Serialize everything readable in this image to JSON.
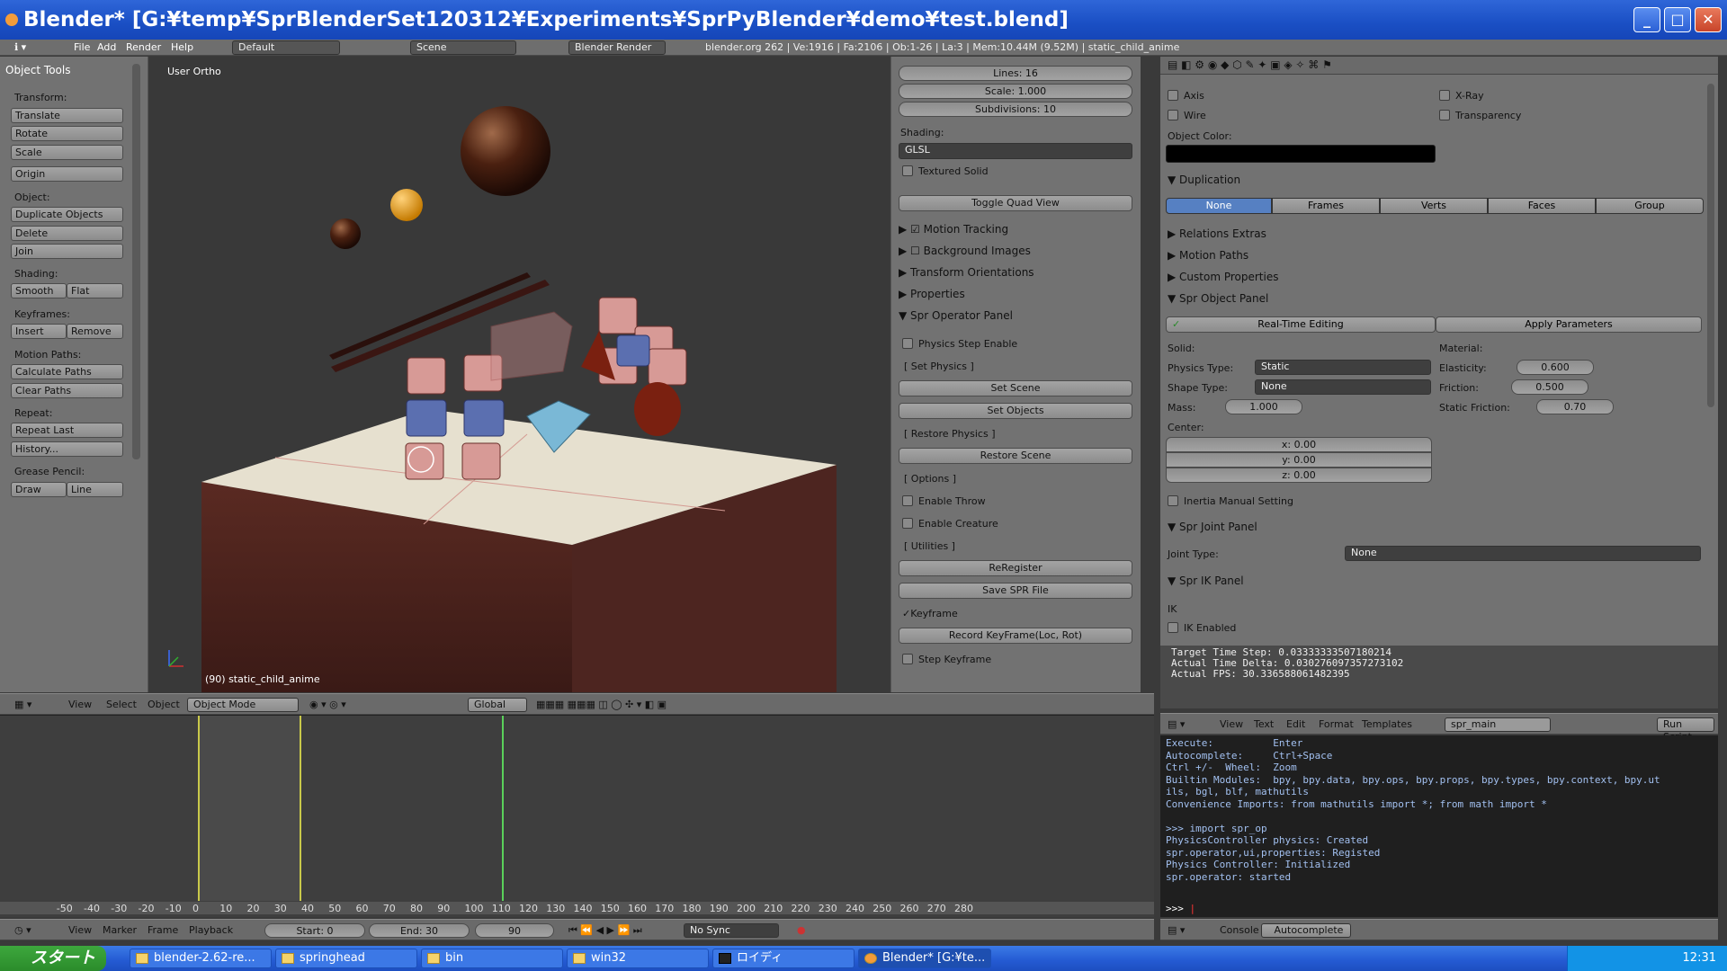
{
  "window": {
    "title": "Blender* [G:¥temp¥SprBlenderSet120312¥Experiments¥SprPyBlender¥demo¥test.blend]"
  },
  "menubar": {
    "menus": [
      "File",
      "Add",
      "Render",
      "Help"
    ],
    "layout": "Default",
    "scene": "Scene",
    "engine": "Blender Render",
    "stats": "blender.org 262 | Ve:1916 | Fa:2106 | Ob:1-26 | La:3 | Mem:10.44M (9.52M) | static_child_anime"
  },
  "toolshelf": {
    "title": "Object Tools",
    "transform_label": "Transform:",
    "translate": "Translate",
    "rotate": "Rotate",
    "scale": "Scale",
    "origin": "Origin",
    "object_label": "Object:",
    "duplicate": "Duplicate Objects",
    "delete": "Delete",
    "join": "Join",
    "shading_label": "Shading:",
    "smooth": "Smooth",
    "flat": "Flat",
    "keyframes_label": "Keyframes:",
    "insert": "Insert",
    "remove": "Remove",
    "motion_label": "Motion Paths:",
    "calc_paths": "Calculate Paths",
    "clear_paths": "Clear Paths",
    "repeat_label": "Repeat:",
    "repeat_last": "Repeat Last",
    "history": "History...",
    "grease_label": "Grease Pencil:",
    "draw": "Draw",
    "line": "Line"
  },
  "viewport": {
    "view_name": "User Ortho",
    "object_info": "(90) static_child_anime"
  },
  "npanel": {
    "lines": "Lines: 16",
    "scale": "Scale: 1.000",
    "subdivisions": "Subdivisions: 10",
    "shading_label": "Shading:",
    "shading_value": "GLSL",
    "textured_solid": "Textured Solid",
    "toggle_quad": "Toggle Quad View",
    "motion_tracking": "Motion Tracking",
    "background_images": "Background Images",
    "transform_orientations": "Transform Orientations",
    "properties": "Properties",
    "spr_operator_panel": "Spr Operator Panel",
    "physics_step": "Physics Step Enable",
    "set_physics": "[ Set Physics ]",
    "set_scene": "Set Scene",
    "set_objects": "Set Objects",
    "restore_physics": "[ Restore Physics ]",
    "restore_scene": "Restore Scene",
    "options": "[ Options ]",
    "enable_throw": "Enable Throw",
    "enable_creature": "Enable Creature",
    "utilities": "[ Utilities ]",
    "reregister": "ReRegister",
    "save_spr": "Save SPR File",
    "keyframe": "Keyframe",
    "record_keyframe": "Record KeyFrame(Loc, Rot)",
    "step_keyframe": "Step Keyframe"
  },
  "props": {
    "axis": "Axis",
    "xray": "X-Ray",
    "wire": "Wire",
    "transparency": "Transparency",
    "object_color": "Object Color:",
    "duplication": "Duplication",
    "dup_options": [
      "None",
      "Frames",
      "Verts",
      "Faces",
      "Group"
    ],
    "relations_extras": "Relations Extras",
    "motion_paths": "Motion Paths",
    "custom_properties": "Custom Properties",
    "spr_object_panel": "Spr Object Panel",
    "realtime_editing": "Real-Time Editing",
    "apply_parameters": "Apply Parameters",
    "solid": "Solid:",
    "material": "Material:",
    "physics_type_label": "Physics Type:",
    "physics_type": "Static",
    "shape_type_label": "Shape Type:",
    "shape_type": "None",
    "mass_label": "Mass:",
    "mass": "1.000",
    "elasticity_label": "Elasticity:",
    "elasticity": "0.600",
    "friction_label": "Friction:",
    "friction": "0.500",
    "static_friction_label": "Static Friction:",
    "static_friction": "0.70",
    "center": "Center:",
    "cx": "x: 0.00",
    "cy": "y: 0.00",
    "cz": "z: 0.00",
    "inertia_manual": "Inertia Manual Setting",
    "spr_joint_panel": "Spr Joint Panel",
    "joint_type_label": "Joint Type:",
    "joint_type": "None",
    "spr_ik_panel": "Spr IK Panel",
    "ik": "IK",
    "ik_enabled": "IK Enabled"
  },
  "info": {
    "line1": "Target Time Step: 0.03333333507180214",
    "line2": "Actual Time Delta: 0.030276097357273102",
    "line3": "Actual FPS: 30.336588061482395"
  },
  "texteditor": {
    "menus": [
      "View",
      "Text",
      "Edit",
      "Format",
      "Templates"
    ],
    "file": "spr_main",
    "run_script": "Run Script"
  },
  "console": {
    "lines": [
      "Execute:          Enter",
      "Autocomplete:     Ctrl+Space",
      "Ctrl +/-  Wheel:  Zoom",
      "Builtin Modules:  bpy, bpy.data, bpy.ops, bpy.props, bpy.types, bpy.context, bpy.ut",
      "ils, bgl, blf, mathutils",
      "Convenience Imports: from mathutils import *; from math import *",
      "",
      ">>> import spr_op",
      "PhysicsController physics: Created",
      "spr.operator,ui,properties: Registed",
      "Physics Controller: Initialized",
      "spr.operator: started"
    ],
    "prompt": ">>> ",
    "footer_console": "Console",
    "footer_autocomplete": "Autocomplete"
  },
  "viewport_header": {
    "menus": [
      "View",
      "Select",
      "Object"
    ],
    "mode": "Object Mode",
    "orientation": "Global"
  },
  "timeline": {
    "ticks": [
      "-50",
      "-40",
      "-30",
      "-20",
      "-10",
      "0",
      "10",
      "20",
      "30",
      "40",
      "50",
      "60",
      "70",
      "80",
      "90",
      "100",
      "110",
      "120",
      "130",
      "140",
      "150",
      "160",
      "170",
      "180",
      "190",
      "200",
      "210",
      "220",
      "230",
      "240",
      "250",
      "260",
      "270",
      "280"
    ],
    "menus": [
      "View",
      "Marker",
      "Frame",
      "Playback"
    ],
    "start": "Start: 0",
    "end": "End: 30",
    "current": "90",
    "sync": "No Sync"
  },
  "taskbar": {
    "start": "スタート",
    "tasks": [
      "blender-2.62-re...",
      "springhead",
      "bin",
      "win32",
      "ロイディ",
      "Blender* [G:¥te..."
    ],
    "clock": "12:31"
  }
}
